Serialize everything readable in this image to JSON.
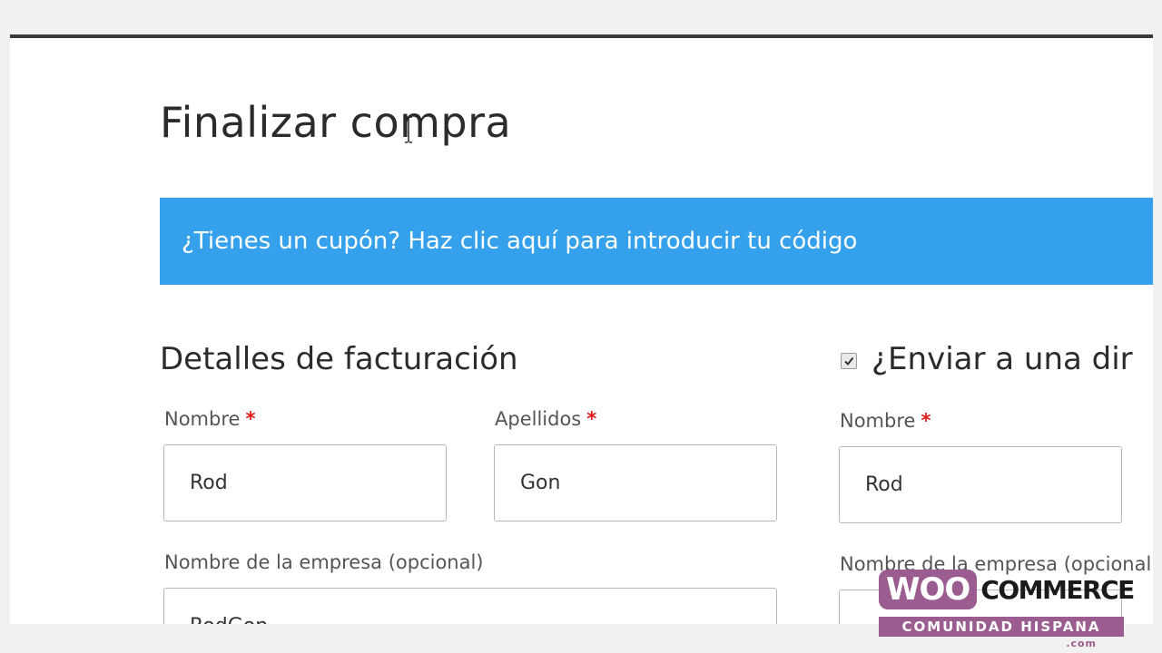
{
  "page": {
    "title": "Finalizar compra"
  },
  "coupon": {
    "text": "¿Tienes un cupón? Haz clic aquí para introducir tu código"
  },
  "billing": {
    "heading": "Detalles de facturación",
    "first_name": {
      "label": "Nombre",
      "required": "*",
      "value": "Rod"
    },
    "last_name": {
      "label": "Apellidos",
      "required": "*",
      "value": "Gon"
    },
    "company": {
      "label": "Nombre de la empresa (opcional)",
      "value": "RodGon"
    }
  },
  "shipping": {
    "heading": "¿Enviar a una dir",
    "checked": true,
    "first_name": {
      "label": "Nombre",
      "required": "*",
      "value": "Rod"
    },
    "company": {
      "label": "Nombre de la empresa (opcional)"
    }
  },
  "watermark": {
    "woo": "WOO",
    "commerce": "COMMERCE",
    "band": "COMUNIDAD HISPANA",
    "suffix": ".com"
  },
  "colors": {
    "banner": "#35a1ec",
    "required": "#e01b1b",
    "woo_purple": "#9b5c8f"
  }
}
